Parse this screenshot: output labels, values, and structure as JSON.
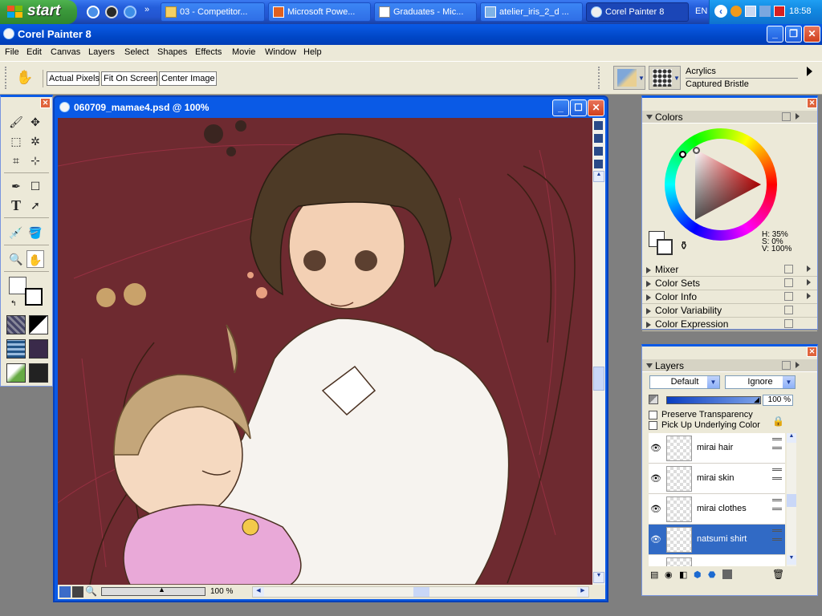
{
  "taskbar": {
    "start_label": "start",
    "buttons": [
      "03 - Competitor...",
      "Microsoft Powe...",
      "Graduates - Mic...",
      "atelier_iris_2_d ...",
      "Corel Painter 8"
    ],
    "language": "EN",
    "clock": "18:58"
  },
  "app": {
    "title": "Corel Painter 8",
    "menu": [
      "File",
      "Edit",
      "Canvas",
      "Layers",
      "Select",
      "Shapes",
      "Effects",
      "Movie",
      "Window",
      "Help"
    ]
  },
  "propbar": {
    "buttons": [
      "Actual Pixels",
      "Fit On Screen",
      "Center Image"
    ],
    "brush_category": "Acrylics",
    "brush_variant": "Captured Bristle"
  },
  "document": {
    "title": "060709_mamae4.psd @ 100%",
    "zoom": "100 %"
  },
  "colors_panel": {
    "title": "Colors",
    "hsv": [
      "H: 35%",
      "S: 0%",
      "V: 100%"
    ],
    "sections": [
      "Mixer",
      "Color Sets",
      "Color Info",
      "Color Variability",
      "Color Expression"
    ]
  },
  "layers_panel": {
    "title": "Layers",
    "composite_method": "Default",
    "depth": "Ignore",
    "opacity": "100 %",
    "preserve_transparency": "Preserve Transparency",
    "pick_up_underlying": "Pick Up Underlying Color",
    "layers": [
      "mirai hair",
      "mirai skin",
      "mirai clothes",
      "natsumi shirt"
    ],
    "selected_index": 3
  },
  "colors": {
    "canvas_bg": "#6e2a30",
    "xp_blue": "#0a5ae6",
    "selected": "#316ac5"
  }
}
